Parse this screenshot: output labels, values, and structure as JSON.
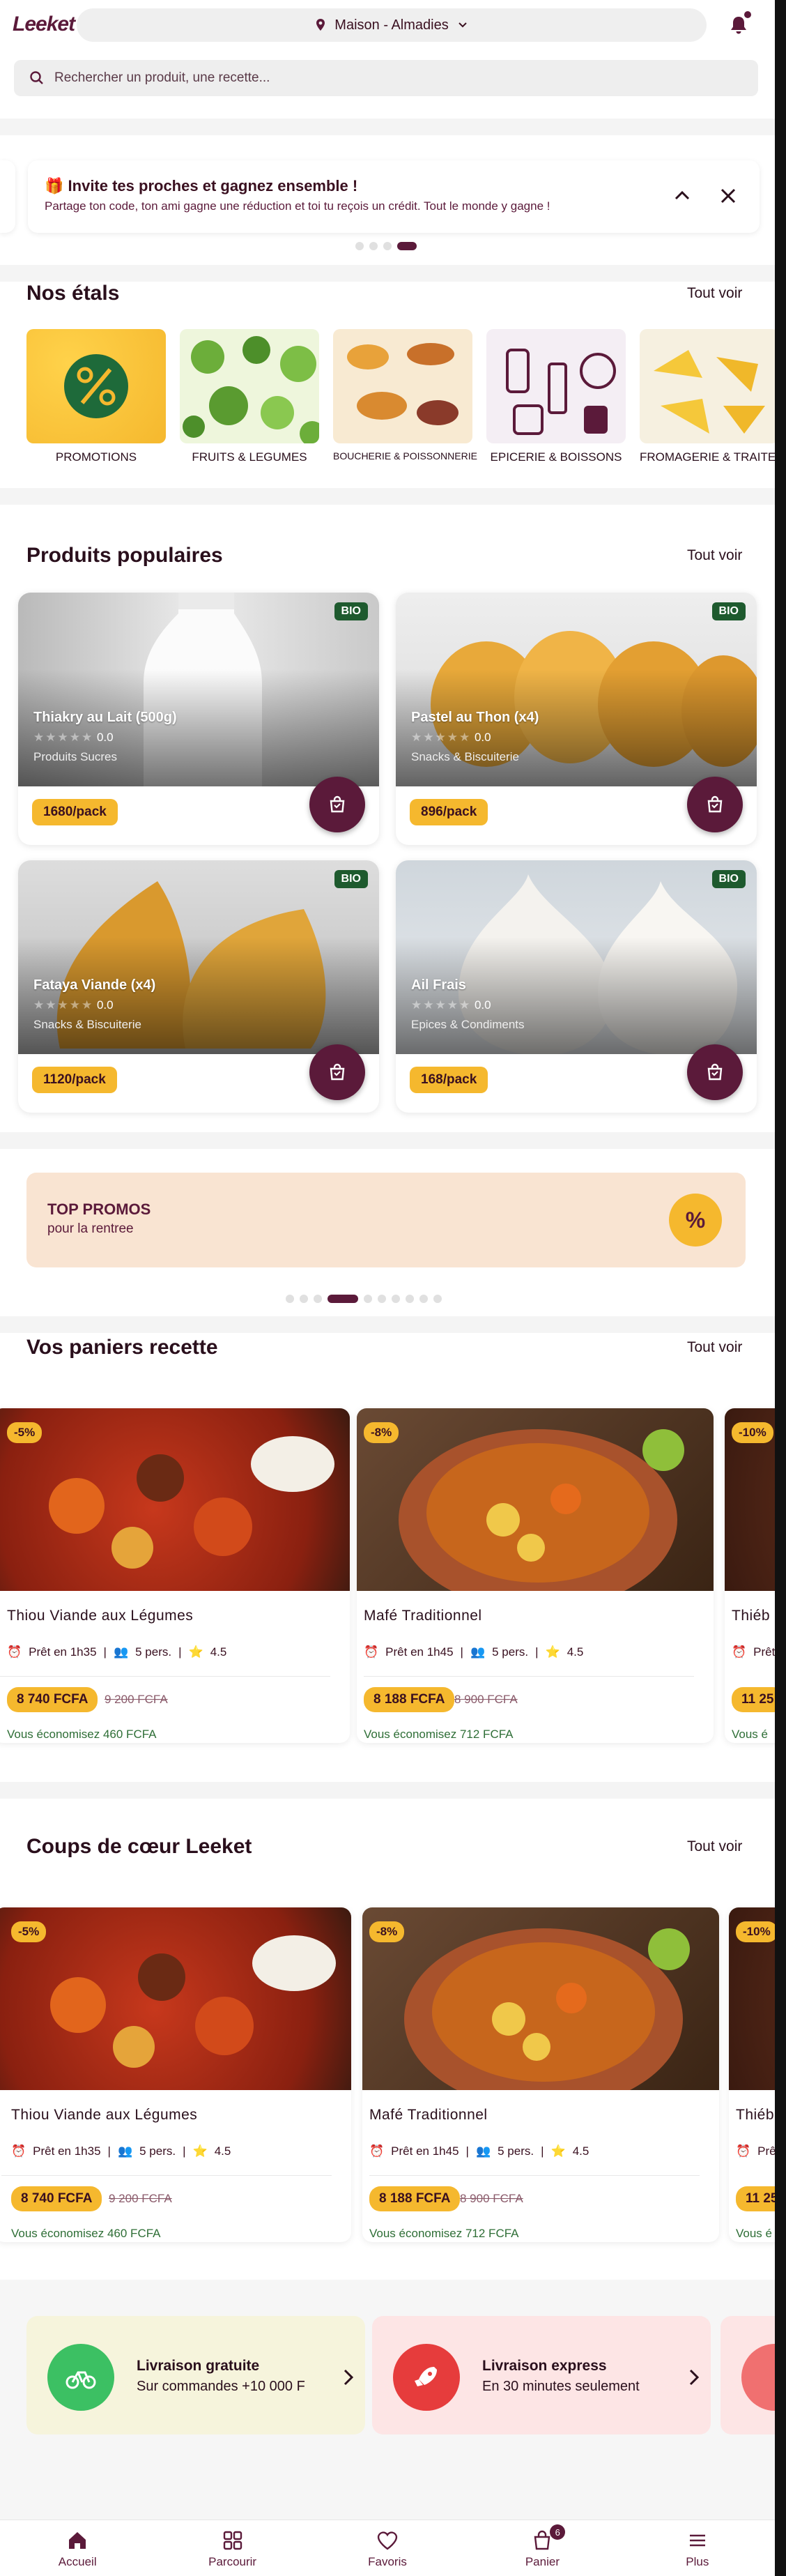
{
  "header": {
    "logo": "Leeket",
    "location": "Maison - Almadies",
    "search_placeholder": "Rechercher un produit, une recette..."
  },
  "invite": {
    "emoji": "🎁",
    "title": "Invite tes proches et gagnez ensemble !",
    "subtitle": "Partage ton code, ton ami gagne une réduction et toi tu reçois un crédit. Tout le monde y gagne !"
  },
  "stalls": {
    "title": "Nos étals",
    "see_all": "Tout voir",
    "items": [
      {
        "label": "PROMOTIONS"
      },
      {
        "label": "FRUITS & LEGUMES"
      },
      {
        "label": "BOUCHERIE & POISSONNERIE"
      },
      {
        "label": "EPICERIE & BOISSONS"
      },
      {
        "label": "FROMAGERIE & TRAITEUR"
      }
    ]
  },
  "popular": {
    "title": "Produits populaires",
    "see_all": "Tout voir",
    "items": [
      {
        "badge": "BIO",
        "name": "Thiakry au Lait (500g)",
        "rating": "0.0",
        "category": "Produits Sucres",
        "price": "1680/pack"
      },
      {
        "badge": "BIO",
        "name": "Pastel au Thon (x4)",
        "rating": "0.0",
        "category": "Snacks & Biscuiterie",
        "price": "896/pack"
      },
      {
        "badge": "BIO",
        "name": "Fataya Viande (x4)",
        "rating": "0.0",
        "category": "Snacks & Biscuiterie",
        "price": "1120/pack"
      },
      {
        "badge": "BIO",
        "name": "Ail Frais",
        "rating": "0.0",
        "category": "Epices & Condiments",
        "price": "168/pack"
      }
    ]
  },
  "promo": {
    "title": "TOP PROMOS",
    "subtitle": "pour la rentree",
    "icon_text": "%"
  },
  "baskets": {
    "title": "Vos paniers recette",
    "see_all": "Tout voir",
    "items": [
      {
        "discount": "-5%",
        "name": "Thiou Viande aux Légumes",
        "time": "Prêt en 1h35",
        "persons": "5 pers.",
        "rating": "4.5",
        "price": "8 740 FCFA",
        "old_price": "9 200 FCFA",
        "saving": "Vous économisez 460 FCFA"
      },
      {
        "discount": "-8%",
        "name": "Mafé Traditionnel",
        "time": "Prêt en 1h45",
        "persons": "5 pers.",
        "rating": "4.5",
        "price": "8 188 FCFA",
        "old_price": "8 900 FCFA",
        "saving": "Vous économisez 712 FCFA"
      },
      {
        "discount": "-10%",
        "name": "Thiéb",
        "time": "Prêt",
        "persons": "",
        "rating": "",
        "price": "11 25",
        "old_price": "",
        "saving": "Vous é"
      }
    ]
  },
  "favorites": {
    "title": "Coups de cœur Leeket",
    "see_all": "Tout voir",
    "items": [
      {
        "discount": "-5%",
        "name": "Thiou Viande aux Légumes",
        "time": "Prêt en 1h35",
        "persons": "5 pers.",
        "rating": "4.5",
        "price": "8 740 FCFA",
        "old_price": "9 200 FCFA",
        "saving": "Vous économisez 460 FCFA"
      },
      {
        "discount": "-8%",
        "name": "Mafé Traditionnel",
        "time": "Prêt en 1h45",
        "persons": "5 pers.",
        "rating": "4.5",
        "price": "8 188 FCFA",
        "old_price": "8 900 FCFA",
        "saving": "Vous économisez 712 FCFA"
      },
      {
        "discount": "-10%",
        "name": "Thiéb",
        "time": "Prêt",
        "persons": "",
        "rating": "",
        "price": "11 25",
        "old_price": "",
        "saving": "Vous é"
      }
    ]
  },
  "features": [
    {
      "title": "Livraison gratuite",
      "subtitle": "Sur commandes +10 000 F",
      "icon": "bike-icon",
      "color": "#3cc063",
      "bg": "#f6f4dc"
    },
    {
      "title": "Livraison express",
      "subtitle": "En 30 minutes seulement",
      "icon": "rocket-icon",
      "color": "#e63c3c",
      "bg": "#fde5e5"
    }
  ],
  "nav": {
    "items": [
      {
        "label": "Accueil",
        "icon": "home-icon"
      },
      {
        "label": "Parcourir",
        "icon": "grid-icon"
      },
      {
        "label": "Favoris",
        "icon": "heart-icon"
      },
      {
        "label": "Panier",
        "icon": "cart-icon",
        "badge": "6"
      },
      {
        "label": "Plus",
        "icon": "menu-icon"
      }
    ]
  },
  "colors": {
    "brand": "#5b1a3a",
    "accent": "#f5b82e",
    "bio": "#1e5a2e"
  }
}
